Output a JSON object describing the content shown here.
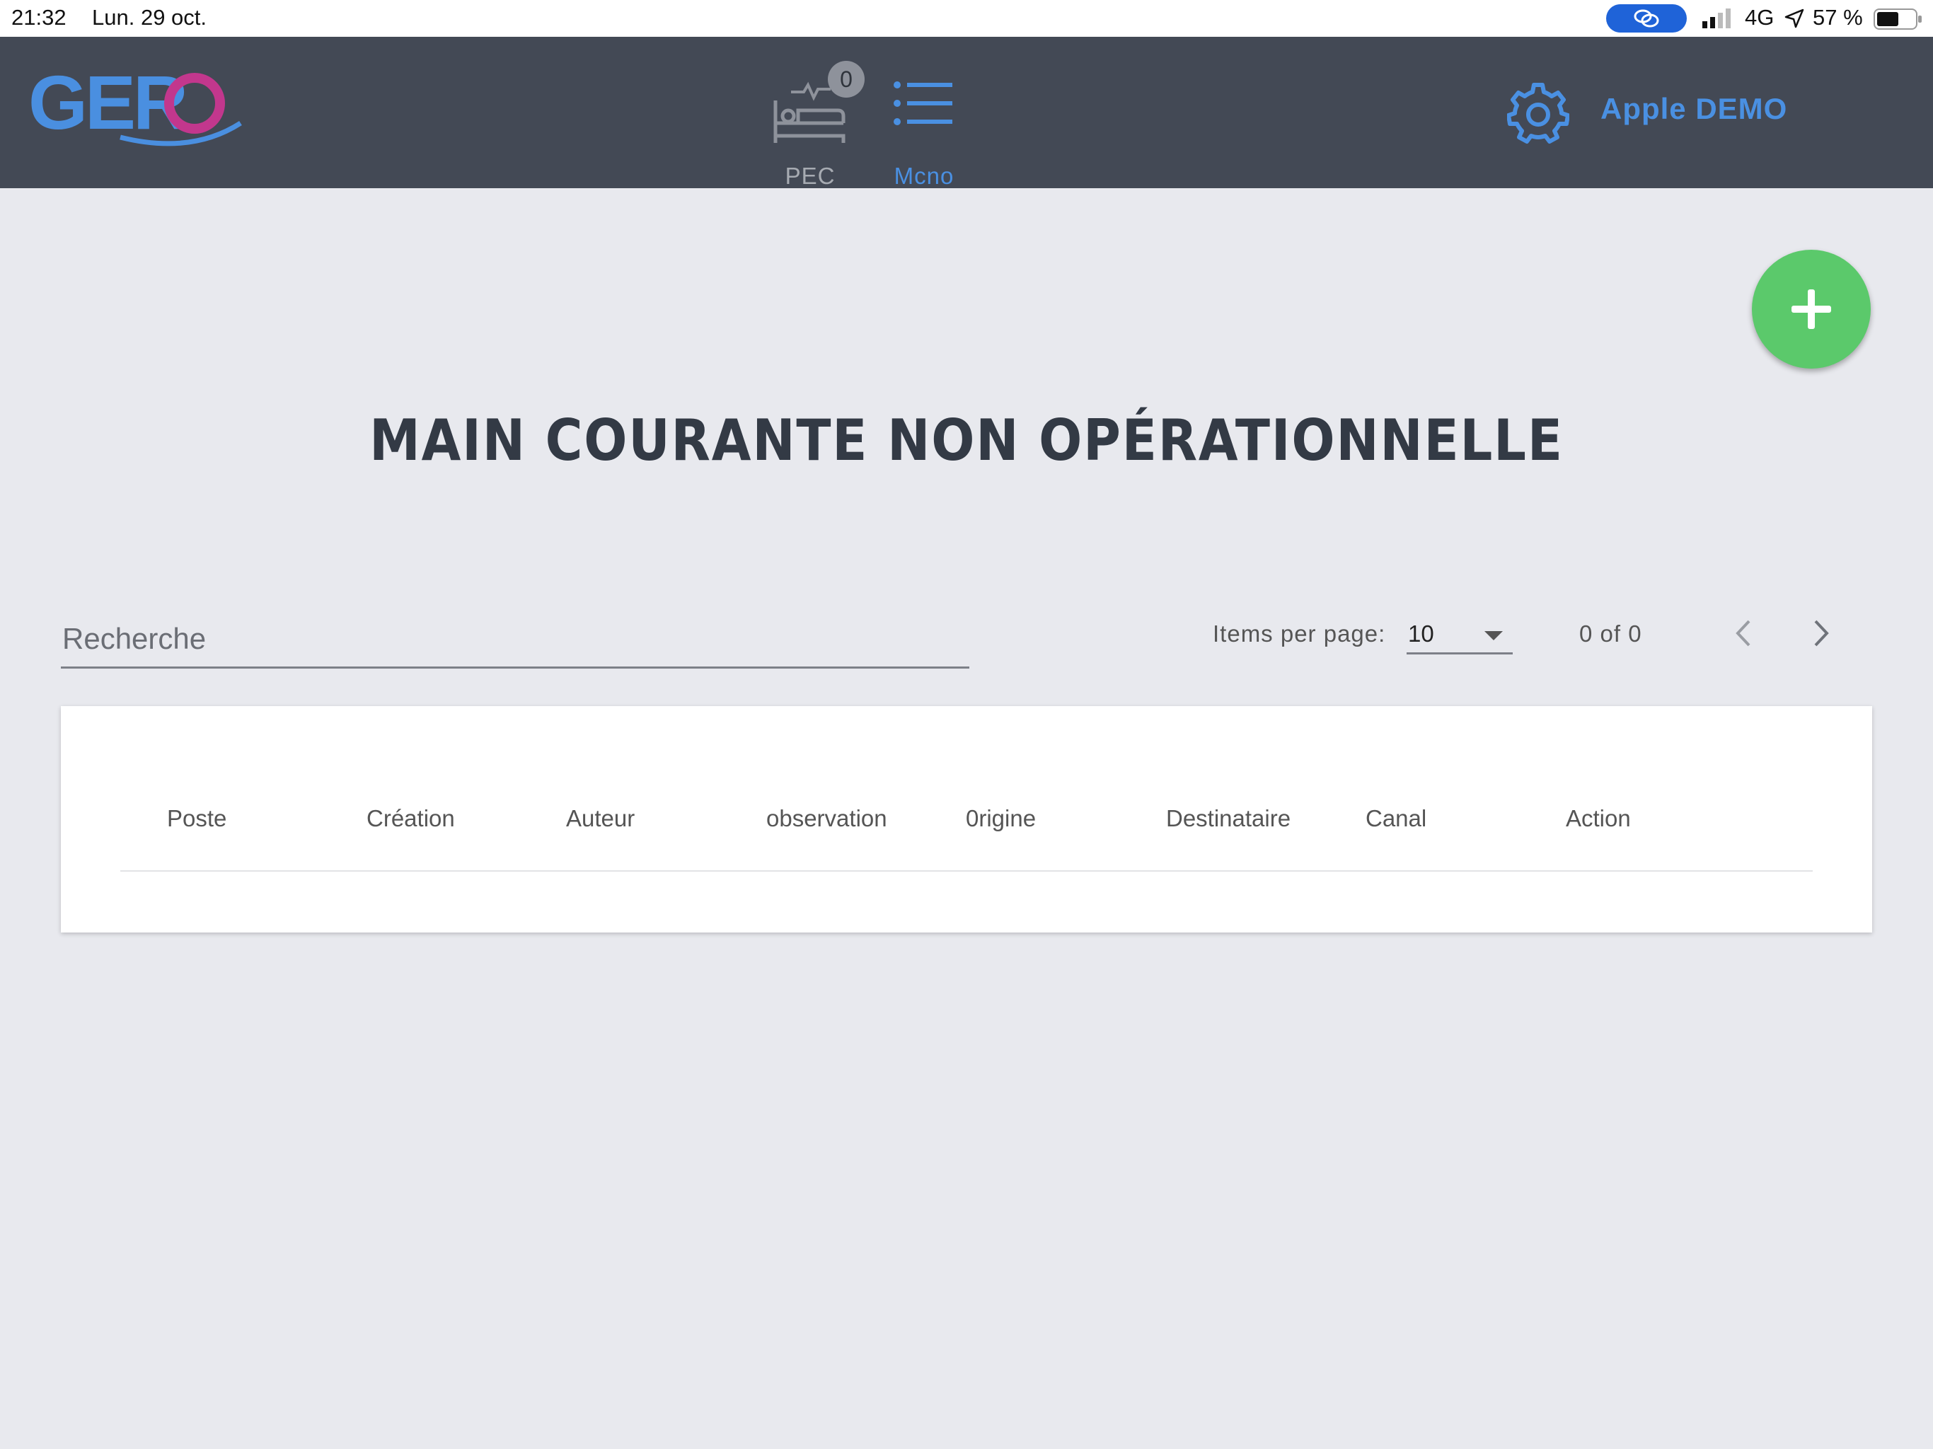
{
  "status_bar": {
    "time": "21:32",
    "date": "Lun. 29 oct.",
    "network": "4G",
    "battery_percent": "57 %",
    "battery_level": 0.57
  },
  "header": {
    "logo_text": "GERO",
    "nav": [
      {
        "label": "PEC",
        "badge": "0",
        "icon": "bed-monitor-icon",
        "active": false
      },
      {
        "label": "Mcno",
        "icon": "list-icon",
        "active": true
      }
    ],
    "user_name": "Apple DEMO",
    "accent_color": "#4a90e2",
    "background_color": "#434955"
  },
  "fab": {
    "icon": "plus-icon",
    "color": "#5bc96b"
  },
  "page_title": "MAIN COURANTE NON OPÉRATIONNELLE",
  "search": {
    "placeholder": "Recherche",
    "value": ""
  },
  "pagination": {
    "items_per_page_label": "Items per page:",
    "items_per_page_value": "10",
    "range_label": "0 of 0"
  },
  "table": {
    "columns": [
      "Poste",
      "Création",
      "Auteur",
      "observation",
      "0rigine",
      "Destinataire",
      "Canal",
      "Action"
    ],
    "rows": []
  }
}
